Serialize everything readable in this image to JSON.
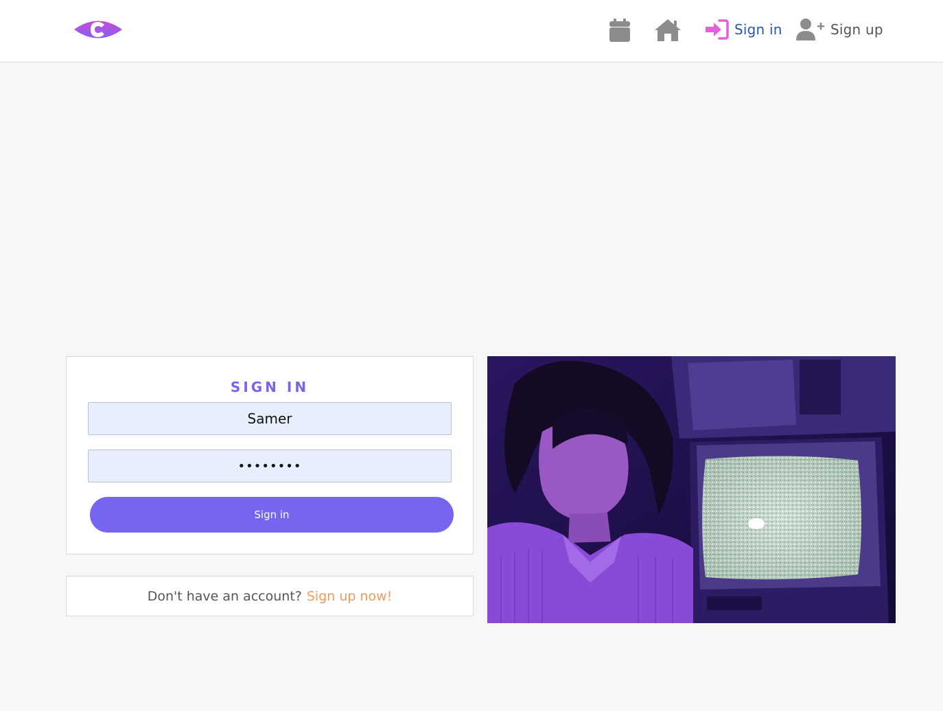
{
  "header": {
    "logo_icon": "eye-c-logo",
    "nav": {
      "calendar_icon": "calendar-icon",
      "home_icon": "home-icon",
      "signin_label": "Sign in",
      "signin_icon": "sign-in-arrow-icon",
      "signup_label": "Sign up",
      "signup_icon": "user-plus-icon"
    }
  },
  "signin_form": {
    "title": "SIGN IN",
    "username_value": "Samer",
    "password_value": "••••••••",
    "submit_label": "Sign in"
  },
  "signup_prompt": {
    "text": "Don't have an account?",
    "link_label": "Sign up now!"
  },
  "colors": {
    "accent_purple": "#7665ee",
    "title_purple": "#7b63ec",
    "signin_link": "#2a56a8",
    "signin_icon": "#e35fdc",
    "signup_link_orange": "#f29a5c",
    "input_bg": "#e8effc",
    "page_bg": "#f7f7f7"
  }
}
